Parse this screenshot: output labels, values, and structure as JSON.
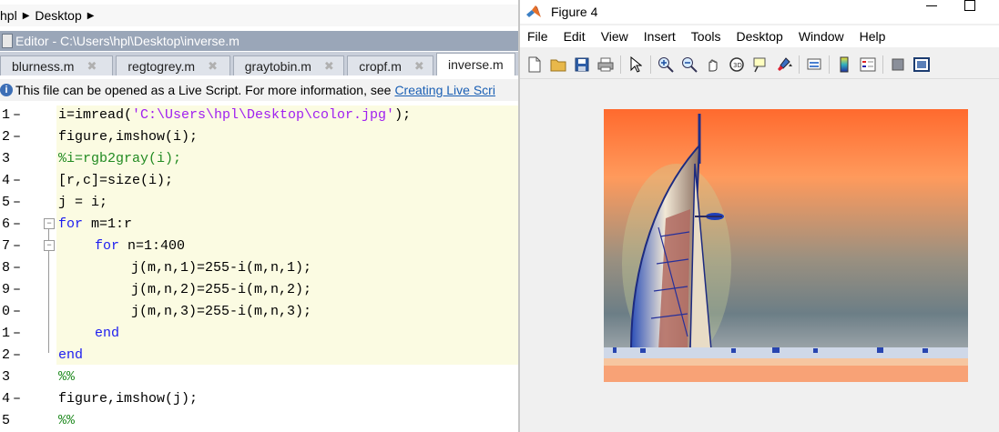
{
  "breadcrumb": {
    "items": [
      "hpl",
      "Desktop"
    ]
  },
  "editor": {
    "title": "Editor - C:\\Users\\hpl\\Desktop\\inverse.m",
    "tabs": [
      {
        "label": "blurness.m",
        "active": false
      },
      {
        "label": "regtogrey.m",
        "active": false
      },
      {
        "label": "graytobin.m",
        "active": false
      },
      {
        "label": "cropf.m",
        "active": false
      },
      {
        "label": "inverse.m",
        "active": true
      }
    ],
    "info": {
      "text": "This file can be opened as a Live Script. For more information, see",
      "link": "Creating Live Scri"
    },
    "lines": [
      {
        "num": "1",
        "dash": "–"
      },
      {
        "num": "2",
        "dash": "–"
      },
      {
        "num": "3",
        "dash": ""
      },
      {
        "num": "4",
        "dash": "–"
      },
      {
        "num": "5",
        "dash": "–"
      },
      {
        "num": "6",
        "dash": "–"
      },
      {
        "num": "7",
        "dash": "–"
      },
      {
        "num": "8",
        "dash": "–"
      },
      {
        "num": "9",
        "dash": "–"
      },
      {
        "num": "0",
        "dash": "–"
      },
      {
        "num": "1",
        "dash": "–"
      },
      {
        "num": "2",
        "dash": "–"
      },
      {
        "num": "3",
        "dash": ""
      },
      {
        "num": "4",
        "dash": "–"
      },
      {
        "num": "5",
        "dash": ""
      }
    ],
    "code": {
      "l1a": "i=imread(",
      "l1b": "'C:\\Users\\hpl\\Desktop\\color.jpg'",
      "l1c": ");",
      "l2": "figure,imshow(i);",
      "l3": "%i=rgb2gray(i);",
      "l4": "[r,c]=size(i);",
      "l5": "j = i;",
      "l6a": "for",
      "l6b": " m=1:r",
      "l7a": "for",
      "l7b": " n=1:400",
      "l8": "j(m,n,1)=255-i(m,n,1);",
      "l9": "j(m,n,2)=255-i(m,n,2);",
      "l10": "j(m,n,3)=255-i(m,n,3);",
      "l11": "end",
      "l12": "end",
      "l13": "%%",
      "l14": "figure,imshow(j);",
      "l15": "%%"
    }
  },
  "figure": {
    "title": "Figure 4",
    "menu": [
      "File",
      "Edit",
      "View",
      "Insert",
      "Tools",
      "Desktop",
      "Window",
      "Help"
    ],
    "toolbar_icons": [
      "new-figure-icon",
      "open-file-icon",
      "save-icon",
      "print-icon",
      "pointer-icon",
      "zoom-in-icon",
      "zoom-out-icon",
      "pan-icon",
      "rotate-3d-icon",
      "data-cursor-icon",
      "brush-icon",
      "link-plot-icon",
      "colorbar-icon",
      "legend-icon",
      "hide-plot-tools-icon",
      "show-plot-tools-icon"
    ]
  },
  "colors": {
    "keyword": "#1d1df0",
    "string": "#a020f0",
    "comment": "#228b22",
    "cell_shade": "#fbfbe2",
    "editor_titlebar": "#9aa6b8"
  }
}
